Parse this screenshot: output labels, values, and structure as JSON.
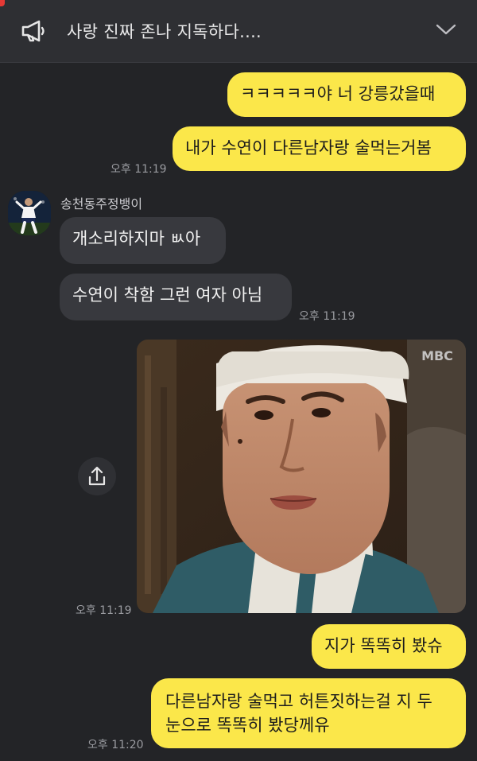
{
  "notice": {
    "text": "사랑 진짜 존나 지독하다....",
    "icon": "megaphone-icon",
    "toggle_icon": "chevron-down-icon"
  },
  "messages": [
    {
      "from": "me",
      "text": "ㅋㅋㅋㅋㅋ야 너 강릉갔을때"
    },
    {
      "from": "me",
      "text": "내가 수연이 다른남자랑 술먹는거봄",
      "time": "오후 11:19"
    },
    {
      "from": "other",
      "sender": "송천동주정뱅이",
      "text": "개소리하지마 ㅄ아"
    },
    {
      "from": "other",
      "text": "수연이 착함 그런 여자 아님",
      "time": "오후 11:19"
    },
    {
      "from": "me",
      "type": "image",
      "watermark": "MBC",
      "time": "오후 11:19"
    },
    {
      "from": "me",
      "text": "지가 똑똑히 봤슈"
    },
    {
      "from": "me",
      "lines": [
        "다른남자랑 술먹고 허튼짓하는걸 지 두",
        "눈으로 똑똑히 봤당께유"
      ],
      "time": "오후 11:20"
    }
  ],
  "colors": {
    "background": "#232427",
    "my_bubble": "#fbe74a",
    "other_bubble": "#38393e"
  }
}
